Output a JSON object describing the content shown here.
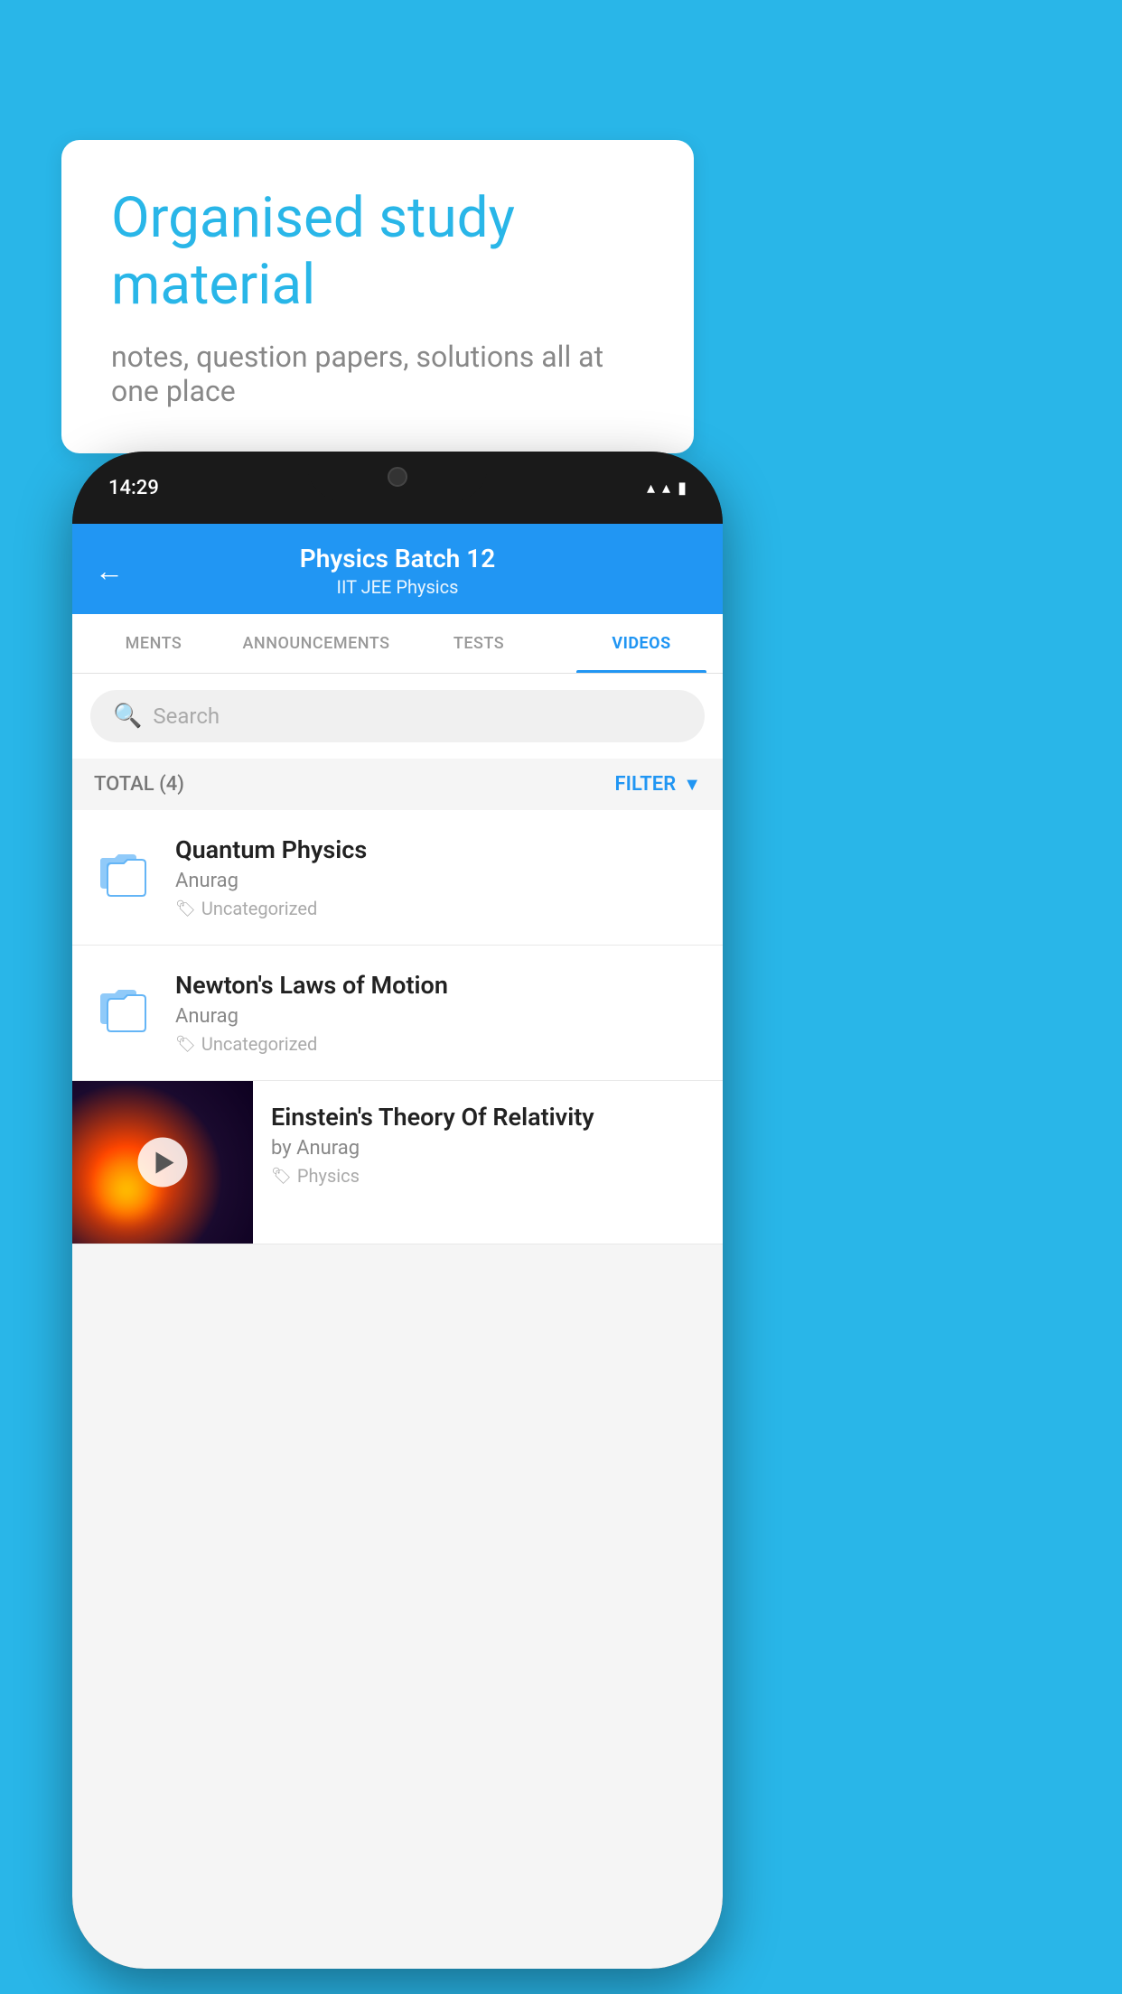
{
  "background_color": "#29b6e8",
  "speech_bubble": {
    "headline": "Organised study material",
    "subtext": "notes, question papers, solutions all at one place"
  },
  "status_bar": {
    "time": "14:29",
    "wifi": "▲",
    "signal": "▲",
    "battery": "▮"
  },
  "app_header": {
    "back_label": "←",
    "batch_name": "Physics Batch 12",
    "batch_tags": "IIT JEE   Physics"
  },
  "tabs": [
    {
      "id": "ments",
      "label": "MENTS",
      "active": false
    },
    {
      "id": "announcements",
      "label": "ANNOUNCEMENTS",
      "active": false
    },
    {
      "id": "tests",
      "label": "TESTS",
      "active": false
    },
    {
      "id": "videos",
      "label": "VIDEOS",
      "active": true
    }
  ],
  "search": {
    "placeholder": "Search"
  },
  "filter_row": {
    "total_label": "TOTAL (4)",
    "filter_label": "FILTER"
  },
  "videos": [
    {
      "id": "quantum",
      "title": "Quantum Physics",
      "author": "Anurag",
      "tag": "Uncategorized",
      "has_thumbnail": false
    },
    {
      "id": "newton",
      "title": "Newton's Laws of Motion",
      "author": "Anurag",
      "tag": "Uncategorized",
      "has_thumbnail": false
    },
    {
      "id": "einstein",
      "title": "Einstein's Theory Of Relativity",
      "author": "by Anurag",
      "tag": "Physics",
      "has_thumbnail": true
    }
  ]
}
